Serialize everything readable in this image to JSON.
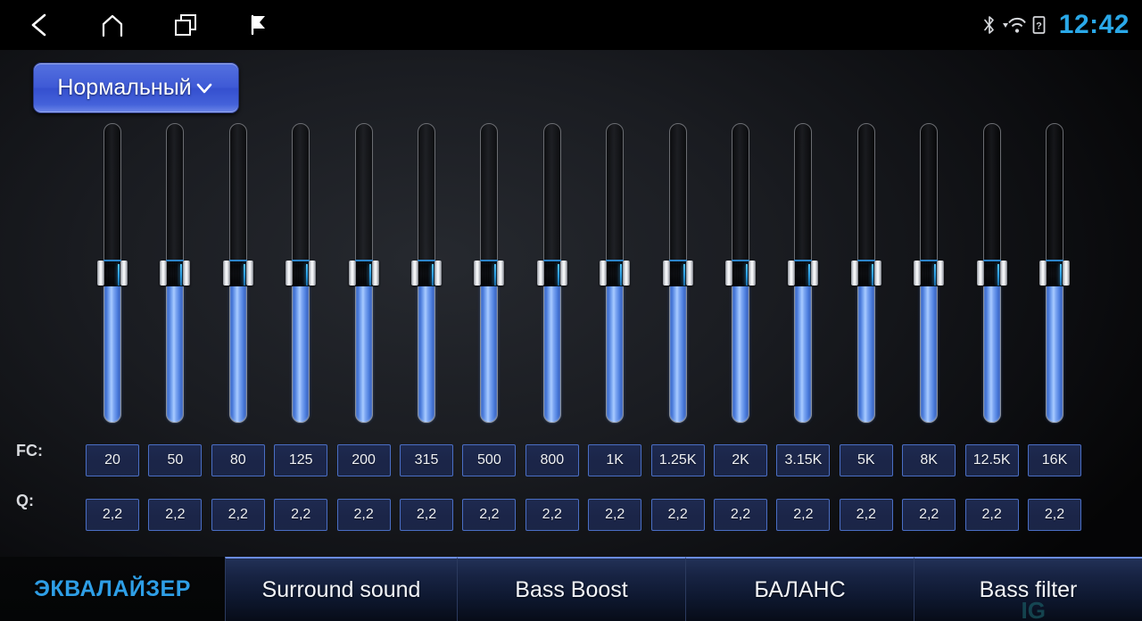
{
  "statusbar": {
    "nav": [
      {
        "name": "back-icon",
        "label": "back"
      },
      {
        "name": "home-icon",
        "label": "home"
      },
      {
        "name": "recent-apps-icon",
        "label": "recent apps"
      },
      {
        "name": "flag-icon",
        "label": "flag"
      }
    ],
    "system_icons": [
      {
        "name": "bluetooth-icon",
        "label": "bluetooth"
      },
      {
        "name": "wifi-icon",
        "label": "wifi"
      },
      {
        "name": "sd-card-icon",
        "label": "sd card"
      }
    ],
    "clock": "12:42",
    "clock_color": "#2aa8e8"
  },
  "preset": {
    "label": "Нормальный",
    "chevron": "chevron-down-icon",
    "accent": "#3f5ad6"
  },
  "equalizer": {
    "fc_row_label": "FC:",
    "q_row_label": "Q:",
    "bands": [
      {
        "fc": "20",
        "q": "2,2",
        "value": 50
      },
      {
        "fc": "50",
        "q": "2,2",
        "value": 50
      },
      {
        "fc": "80",
        "q": "2,2",
        "value": 50
      },
      {
        "fc": "125",
        "q": "2,2",
        "value": 50
      },
      {
        "fc": "200",
        "q": "2,2",
        "value": 50
      },
      {
        "fc": "315",
        "q": "2,2",
        "value": 50
      },
      {
        "fc": "500",
        "q": "2,2",
        "value": 50
      },
      {
        "fc": "800",
        "q": "2,2",
        "value": 50
      },
      {
        "fc": "1K",
        "q": "2,2",
        "value": 50
      },
      {
        "fc": "1.25K",
        "q": "2,2",
        "value": 50
      },
      {
        "fc": "2K",
        "q": "2,2",
        "value": 50
      },
      {
        "fc": "3.15K",
        "q": "2,2",
        "value": 50
      },
      {
        "fc": "5K",
        "q": "2,2",
        "value": 50
      },
      {
        "fc": "8K",
        "q": "2,2",
        "value": 50
      },
      {
        "fc": "12.5K",
        "q": "2,2",
        "value": 50
      },
      {
        "fc": "16K",
        "q": "2,2",
        "value": 50
      }
    ],
    "slider_fill_color": "#6a9bf0",
    "box_border_color": "#4a6ec4"
  },
  "tabs": [
    {
      "label": "ЭКВАЛАЙЗЕР",
      "active": true
    },
    {
      "label": "Surround sound",
      "active": false
    },
    {
      "label": "Bass Boost",
      "active": false
    },
    {
      "label": "БАЛАНС",
      "active": false
    },
    {
      "label": "Bass filter",
      "active": false
    }
  ],
  "watermark": "IG"
}
